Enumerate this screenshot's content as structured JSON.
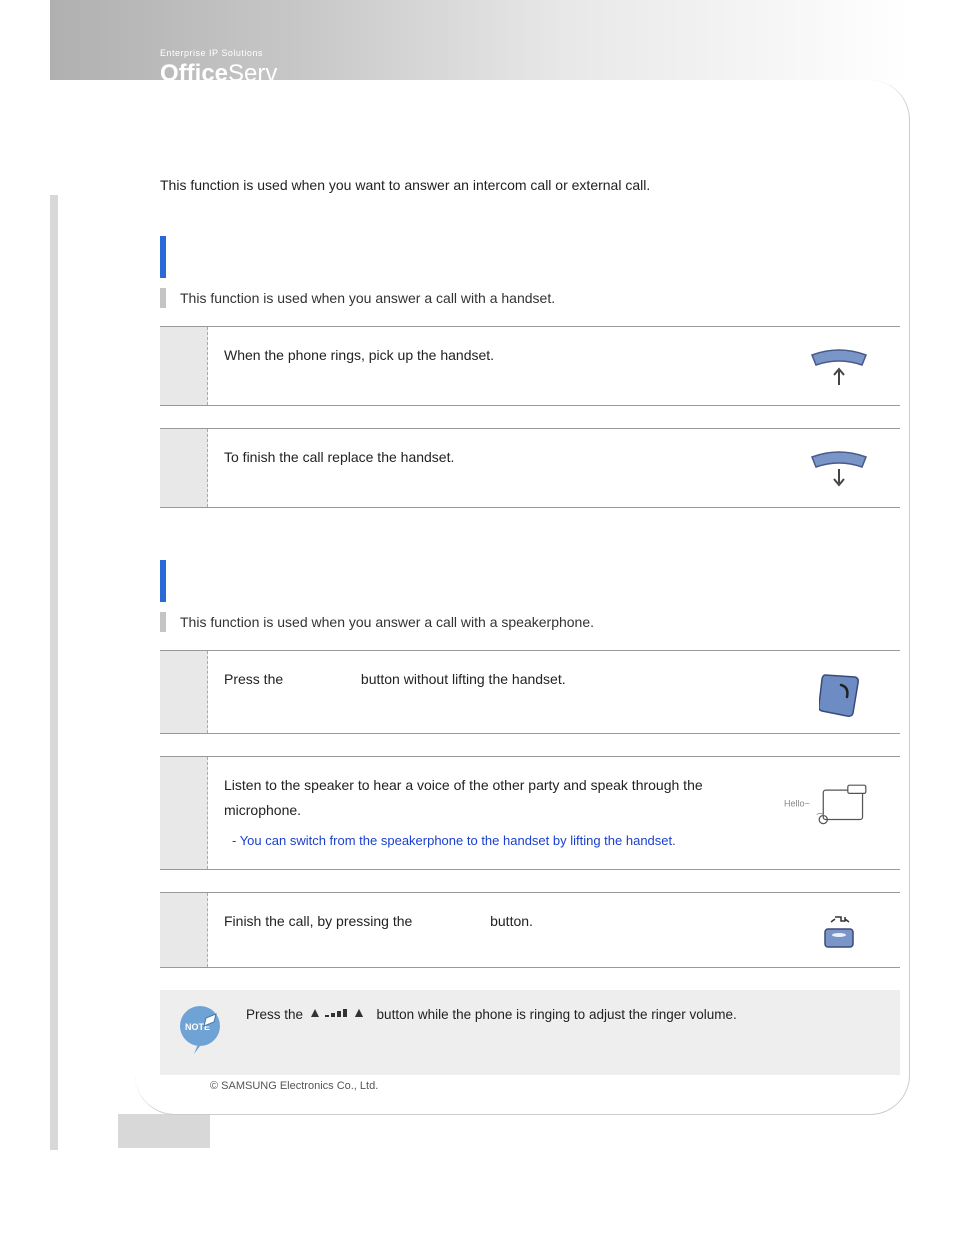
{
  "brand": {
    "tagline": "Enterprise IP Solutions",
    "name_bold": "Office",
    "name_light": "Serv"
  },
  "intro": "This function is used when you want to answer an intercom call or external call.",
  "section1": {
    "desc": "This function is used when you answer a call with a handset.",
    "steps": [
      {
        "text": "When the phone rings, pick up the handset."
      },
      {
        "text": "To finish the call replace the handset."
      }
    ]
  },
  "section2": {
    "desc": "This function is used when you answer a call with a speakerphone.",
    "steps": [
      {
        "text_a": "Press the ",
        "text_b": " button without lifting the handset."
      },
      {
        "text": "Listen to the speaker to hear a voice of the other party and speak through the microphone.",
        "note": "- You can switch from the speakerphone to the handset by lifting the handset.",
        "hello": "Hello~"
      },
      {
        "text_a": "Finish the call, by pressing the ",
        "text_b": " button."
      }
    ]
  },
  "note": {
    "badge": "NOTE",
    "text_a": "Press the ",
    "text_b": " button while the phone is ringing to adjust the ringer volume."
  },
  "footer": "© SAMSUNG Electronics Co., Ltd."
}
